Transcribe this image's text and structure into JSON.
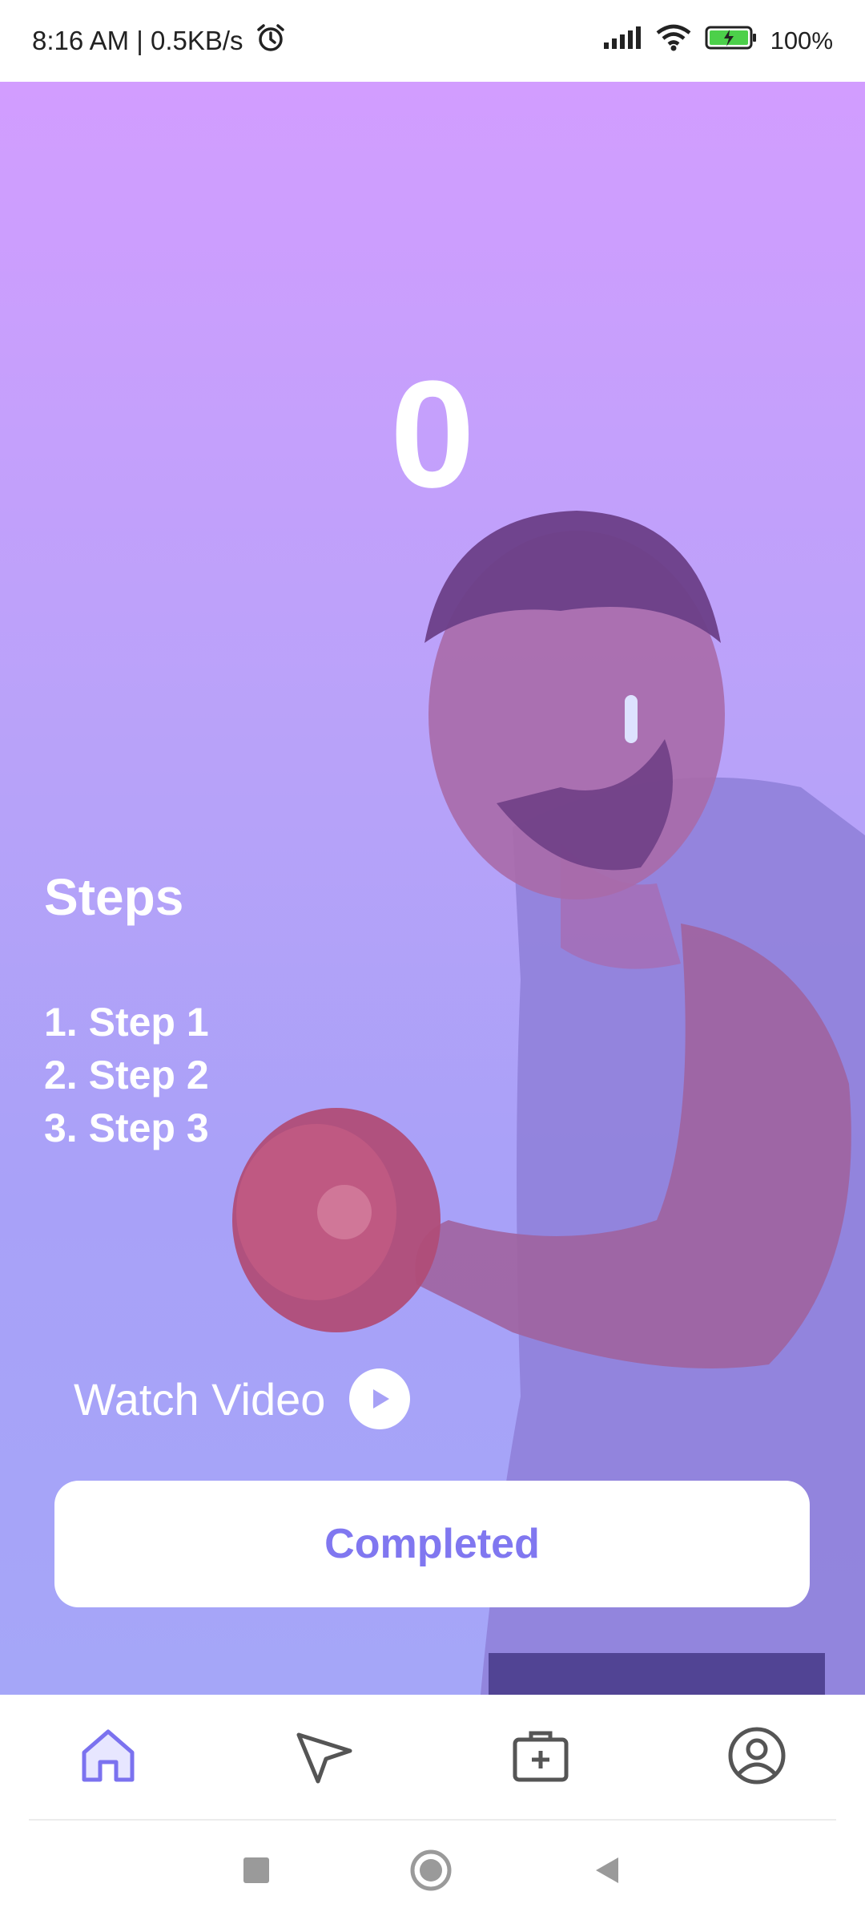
{
  "status_bar": {
    "time": "8:16 AM | 0.5KB/s",
    "battery": "100",
    "battery_unit": "%",
    "icons": [
      "alarm-icon",
      "signal-icon",
      "wifi-icon",
      "battery-charging-icon"
    ]
  },
  "workout": {
    "counter": "0",
    "steps_title": "Steps",
    "steps": [
      "1. Step 1",
      "2. Step 2",
      "3. Step 3"
    ],
    "watch_video_label": "Watch Video",
    "completed_label": "Completed"
  },
  "bottom_nav": {
    "items": [
      {
        "icon": "home-icon",
        "active": true
      },
      {
        "icon": "send-icon",
        "active": false
      },
      {
        "icon": "medical-kit-icon",
        "active": false
      },
      {
        "icon": "profile-icon",
        "active": false
      }
    ]
  },
  "colors": {
    "accent": "#8077f0",
    "gradient_top": "#d29dff",
    "gradient_bottom": "#a5a6f8",
    "nav_inactive": "#555555"
  },
  "system_nav": {
    "buttons": [
      "recents-button",
      "home-button",
      "back-button"
    ]
  }
}
